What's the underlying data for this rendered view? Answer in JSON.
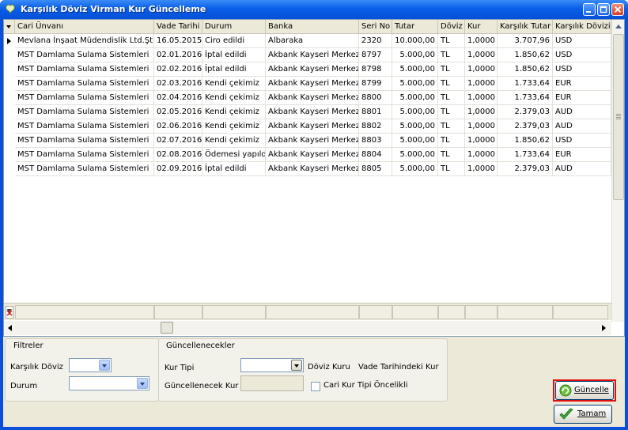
{
  "window": {
    "title": "Karşılık Döviz Virman Kur Güncelleme"
  },
  "grid": {
    "columns": [
      "Cari Ünvanı",
      "Vade Tarihi",
      "Durum",
      "Banka",
      "Seri No",
      "Tutar",
      "Döviz",
      "Kur",
      "Karşılık Tutar",
      "Karşılık Dövizi"
    ],
    "rows": [
      [
        "Mevlana  İnşaat Müdendislik Ltd.Şti",
        "16.05.2015",
        "Ciro edildi",
        "Albaraka",
        "2320",
        "10.000,00",
        "TL",
        "1,0000",
        "3.707,96",
        "USD"
      ],
      [
        "MST Damlama Sulama Sistemleri",
        "02.01.2016",
        "İptal edildi",
        "Akbank Kayseri Merkez",
        "8797",
        "5.000,00",
        "TL",
        "1,0000",
        "1.850,62",
        "USD"
      ],
      [
        "MST Damlama Sulama Sistemleri",
        "02.02.2016",
        "İptal edildi",
        "Akbank Kayseri Merkez",
        "8798",
        "5.000,00",
        "TL",
        "1,0000",
        "1.850,62",
        "USD"
      ],
      [
        "MST Damlama Sulama Sistemleri",
        "02.03.2016",
        "Kendi çekimiz",
        "Akbank Kayseri Merkez",
        "8799",
        "5.000,00",
        "TL",
        "1,0000",
        "1.733,64",
        "EUR"
      ],
      [
        "MST Damlama Sulama Sistemleri",
        "02.04.2016",
        "Kendi çekimiz",
        "Akbank Kayseri Merkez",
        "8800",
        "5.000,00",
        "TL",
        "1,0000",
        "1.733,64",
        "EUR"
      ],
      [
        "MST Damlama Sulama Sistemleri",
        "02.05.2016",
        "Kendi çekimiz",
        "Akbank Kayseri Merkez",
        "8801",
        "5.000,00",
        "TL",
        "1,0000",
        "2.379,03",
        "AUD"
      ],
      [
        "MST Damlama Sulama Sistemleri",
        "02.06.2016",
        "Kendi çekimiz",
        "Akbank Kayseri Merkez",
        "8802",
        "5.000,00",
        "TL",
        "1,0000",
        "2.379,03",
        "AUD"
      ],
      [
        "MST Damlama Sulama Sistemleri",
        "02.07.2016",
        "Kendi çekimiz",
        "Akbank Kayseri Merkez",
        "8803",
        "5.000,00",
        "TL",
        "1,0000",
        "1.850,62",
        "USD"
      ],
      [
        "MST Damlama Sulama Sistemleri",
        "02.08.2016",
        "Ödemesi yapıldı",
        "Akbank Kayseri Merkez",
        "8804",
        "5.000,00",
        "TL",
        "1,0000",
        "1.733,64",
        "EUR"
      ],
      [
        "MST Damlama Sulama Sistemleri",
        "02.09.2016",
        "İptal edildi",
        "Akbank Kayseri Merkez",
        "8805",
        "5.000,00",
        "TL",
        "1,0000",
        "2.379,03",
        "AUD"
      ]
    ],
    "numeric_columns": [
      5,
      7,
      8
    ],
    "selected_row": 0
  },
  "filters": {
    "title": "Filtreler",
    "currency_label": "Karşılık Döviz",
    "currency_value": "",
    "status_label": "Durum",
    "status_value": ""
  },
  "updates": {
    "title": "Güncellenecekler",
    "rate_type_label": "Kur Tipi",
    "rate_type_value": "",
    "option_currency_rate": "Döviz Kuru",
    "option_due_date_rate": "Vade Tarihindeki Kur",
    "rate_to_update_label": "Güncellenecek Kur",
    "priority_checkbox_label": "Cari Kur Tipi Öncelikli",
    "priority_checked": false
  },
  "buttons": {
    "update": "Güncelle",
    "ok": "Tamam"
  },
  "colors": {
    "titlebar": "#0a5fe8",
    "highlight_outline": "#e01010",
    "window_bg": "#ece9d8"
  }
}
